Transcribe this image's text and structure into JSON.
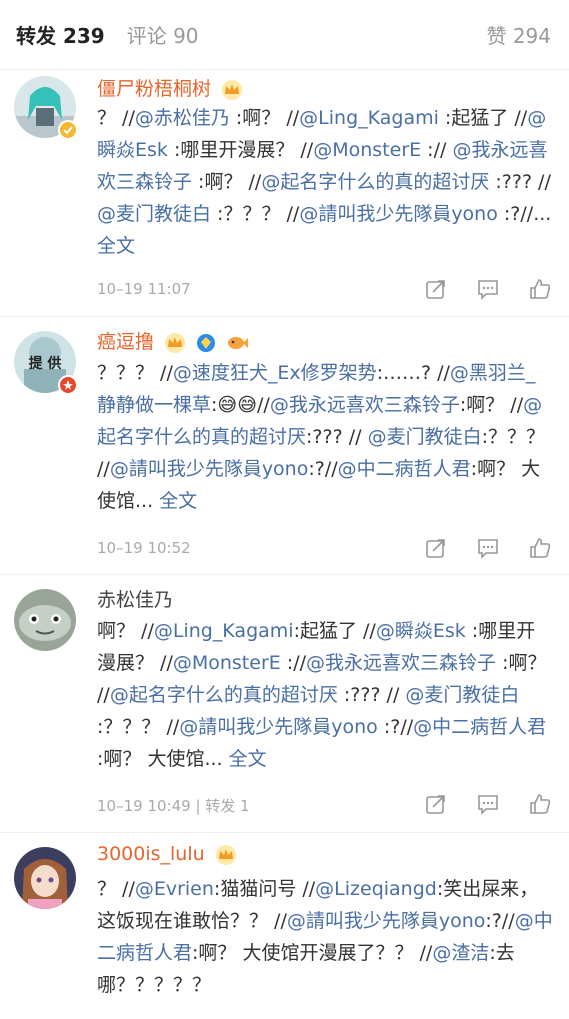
{
  "tabs": {
    "repost_label": "转发 239",
    "comment_label": "评论 90",
    "like_label": "赞 294"
  },
  "posts": [
    {
      "name": "僵尸粉梧桐树",
      "body": [
        {
          "t": "？ //"
        },
        {
          "t": "@赤松佳乃",
          "l": true
        },
        {
          "t": " :啊？ //"
        },
        {
          "t": "@Ling_Kagami",
          "l": true
        },
        {
          "t": " :起猛了 //"
        },
        {
          "t": "@瞬焱Esk",
          "l": true
        },
        {
          "t": " :哪里开漫展？ //"
        },
        {
          "t": "@MonsterE",
          "l": true
        },
        {
          "t": " :// "
        },
        {
          "t": "@我永远喜欢三森铃子",
          "l": true
        },
        {
          "t": " :啊？ //"
        },
        {
          "t": "@起名字什么的真的超讨厌",
          "l": true
        },
        {
          "t": " :??? //"
        },
        {
          "t": "@麦门教徒白",
          "l": true
        },
        {
          "t": " :？？？ //"
        },
        {
          "t": "@請叫我少先隊員yono",
          "l": true
        },
        {
          "t": " :?//... "
        },
        {
          "t": "全文",
          "l": true
        }
      ],
      "meta": "10–19 11:07"
    },
    {
      "name": "癌逗撸",
      "avatar_text": "提 供",
      "body": [
        {
          "t": "？？？ //"
        },
        {
          "t": "@速度狂犬_Ex修罗架势",
          "l": true
        },
        {
          "t": ":……? //"
        },
        {
          "t": "@黑羽兰_静静做一棵草",
          "l": true
        },
        {
          "t": ":😅😅//"
        },
        {
          "t": "@我永远喜欢三森铃子",
          "l": true
        },
        {
          "t": ":啊？ //"
        },
        {
          "t": "@起名字什么的真的超讨厌",
          "l": true
        },
        {
          "t": ":??? // "
        },
        {
          "t": "@麦门教徒白",
          "l": true
        },
        {
          "t": ":？？？ //"
        },
        {
          "t": "@請叫我少先隊員yono",
          "l": true
        },
        {
          "t": ":?//"
        },
        {
          "t": "@中二病哲人君",
          "l": true
        },
        {
          "t": ":啊？ 大使馆... "
        },
        {
          "t": "全文",
          "l": true
        }
      ],
      "meta": "10–19 10:52"
    },
    {
      "name": "赤松佳乃",
      "body": [
        {
          "t": "啊？ //"
        },
        {
          "t": "@Ling_Kagami",
          "l": true
        },
        {
          "t": ":起猛了 //"
        },
        {
          "t": "@瞬焱Esk",
          "l": true
        },
        {
          "t": " :哪里开漫展？ //"
        },
        {
          "t": "@MonsterE",
          "l": true
        },
        {
          "t": " ://"
        },
        {
          "t": "@我永远喜欢三森铃子",
          "l": true
        },
        {
          "t": " :啊？ //"
        },
        {
          "t": "@起名字什么的真的超讨厌",
          "l": true
        },
        {
          "t": " :??? // "
        },
        {
          "t": "@麦门教徒白",
          "l": true
        },
        {
          "t": " :？？？ //"
        },
        {
          "t": "@請叫我少先隊員yono",
          "l": true
        },
        {
          "t": " :?//"
        },
        {
          "t": "@中二病哲人君",
          "l": true
        },
        {
          "t": " :啊？ 大使馆... "
        },
        {
          "t": "全文",
          "l": true
        }
      ],
      "meta": "10–19 10:49 | 转发 1"
    },
    {
      "name": "3000is_lulu",
      "body": [
        {
          "t": "？ //"
        },
        {
          "t": "@Evrien",
          "l": true
        },
        {
          "t": ":猫猫问号 //"
        },
        {
          "t": "@Lizeqiangd",
          "l": true
        },
        {
          "t": ":笑出屎来，这饭现在谁敢恰？？ //"
        },
        {
          "t": "@請叫我少先隊員yono",
          "l": true
        },
        {
          "t": ":?//"
        },
        {
          "t": "@中二病哲人君",
          "l": true
        },
        {
          "t": ":啊？ 大使馆开漫展了？？ //"
        },
        {
          "t": "@渣洁",
          "l": true
        },
        {
          "t": ":去哪？？？？？"
        }
      ]
    }
  ],
  "icons": {
    "share": "share-icon",
    "comment": "comment-icon",
    "like": "thumbs-up-icon",
    "crown": "crown-icon"
  },
  "colors": {
    "link": "#4a6fa5",
    "vip_name": "#e8662b",
    "meta": "#aaaaaa"
  }
}
